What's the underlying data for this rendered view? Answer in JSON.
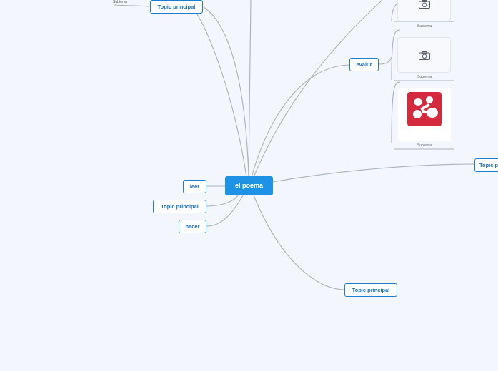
{
  "central": {
    "label": "el poema"
  },
  "topics": {
    "top_left": "Topic principal",
    "evalur": "evalur",
    "right_edge": "Topic p",
    "leer": "leer",
    "left_middle": "Topic principal",
    "hacer": "hacer",
    "bottom": "Topic principal"
  },
  "subtopics": {
    "top_left_sub": "Subtema",
    "card1": "Subtema",
    "card2": "Subtema",
    "card3": "Subtema"
  },
  "logo": {
    "text": "Mindomo",
    "color": "#d52a3e"
  },
  "colors": {
    "background": "#f3f7fd",
    "central_fill": "#1e93e6",
    "topic_border": "#1a7fd1",
    "topic_text": "#1a6fb8",
    "link": "#a9b0bb"
  },
  "icons": [
    "camera-icon",
    "camera-icon",
    "mindomo-logo"
  ]
}
